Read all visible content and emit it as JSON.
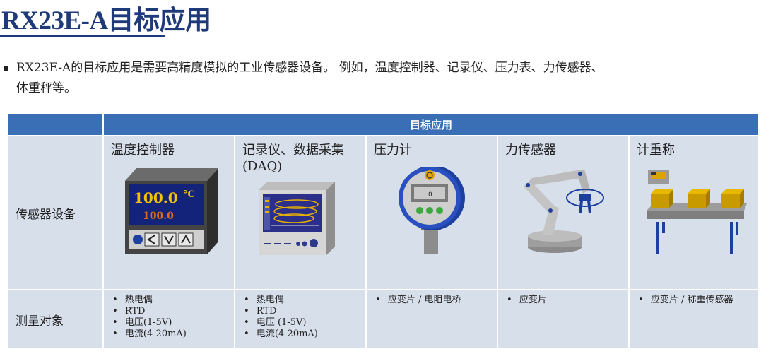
{
  "title": "RX23E-A目标应用",
  "intro": {
    "line1": "RX23E-A的目标应用是需要高精度模拟的工业传感器设备。 例如，温度控制器、记录仪、压力表、力传感器、",
    "line2": "体重秤等。"
  },
  "table": {
    "header": "目标应用",
    "row_labels": [
      "传感器设备",
      "测量对象"
    ],
    "columns": [
      {
        "name": "温度控制器",
        "items": [
          "热电偶",
          "RTD",
          "电压(1-5V)",
          "电流(4-20mA)"
        ]
      },
      {
        "name": "记录仪、数据采集",
        "name_line2": "(DAQ)",
        "items": [
          "热电偶",
          "RTD",
          "电压 (1-5V)",
          "电流(4-20mA)"
        ]
      },
      {
        "name": "压力计",
        "items": [
          "应变片 / 电阻电桥"
        ]
      },
      {
        "name": "力传感器",
        "items": [
          "应变片"
        ]
      },
      {
        "name": "计重称",
        "items": [
          "应变片 / 称重传感器"
        ]
      }
    ]
  },
  "temp_display": {
    "main": "100.0",
    "unit": "°C",
    "sub": "100.0"
  },
  "gauge_display": "0",
  "colors": {
    "title": "#1f3a78",
    "header": "#3a6fb6",
    "cell": "#d7dfeb"
  }
}
